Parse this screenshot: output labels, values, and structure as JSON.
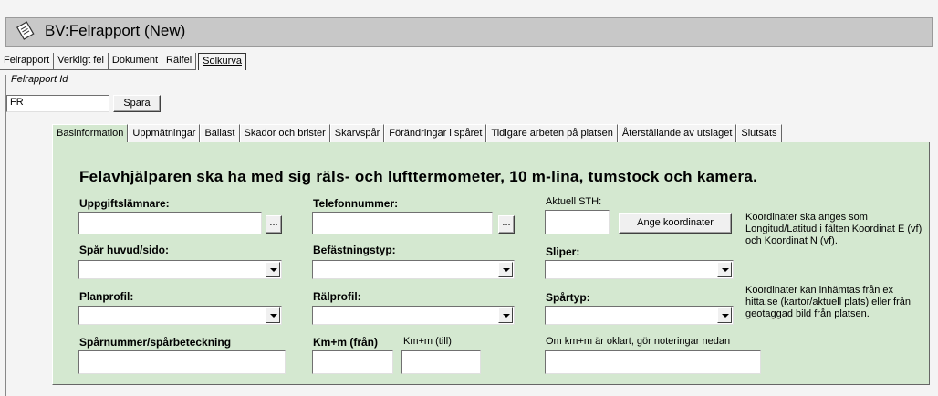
{
  "window": {
    "title": "BV:Felrapport (New)"
  },
  "top_tabs": [
    {
      "label": "Felrapport"
    },
    {
      "label": "Verkligt fel"
    },
    {
      "label": "Dokument"
    },
    {
      "label": "Rälfel"
    },
    {
      "label": "Solkurva"
    }
  ],
  "report_id": {
    "label": "Felrapport Id",
    "value": "FR",
    "save_label": "Spara"
  },
  "sub_tabs": [
    {
      "label": "Basinformation"
    },
    {
      "label": "Uppmätningar"
    },
    {
      "label": "Ballast"
    },
    {
      "label": "Skador och brister"
    },
    {
      "label": "Skarvspår"
    },
    {
      "label": "Förändringar i spåret"
    },
    {
      "label": "Tidigare arbeten på platsen"
    },
    {
      "label": "Återställande av utslaget"
    },
    {
      "label": "Slutsats"
    }
  ],
  "form": {
    "heading": "Felavhjälparen ska ha med sig räls- och lufttermometer, 10 m-lina, tumstock och kamera.",
    "uppgiftslamnare": {
      "label": "Uppgiftslämnare:",
      "value": "",
      "browse": "..."
    },
    "telefonnummer": {
      "label": "Telefonnummer:",
      "value": "",
      "browse": "..."
    },
    "aktuell_sth": {
      "label": "Aktuell STH:",
      "value": ""
    },
    "ange_koordinater": "Ange koordinater",
    "coord_note_1": "Koordinater ska anges som Longitud/Latitud i fälten Koordinat E (vf) och Koordinat N (vf).",
    "coord_note_2": "Koordinater kan inhämtas från ex hitta.se (kartor/aktuell plats) eller från geotaggad bild från platsen.",
    "spar_huvud_sido": {
      "label": "Spår huvud/sido:",
      "value": ""
    },
    "befastningstyp": {
      "label": "Befästningstyp:",
      "value": ""
    },
    "sliper": {
      "label": "Sliper:",
      "value": ""
    },
    "planprofil": {
      "label": "Planprofil:",
      "value": ""
    },
    "ralprofil": {
      "label": "Rälprofil:",
      "value": ""
    },
    "spartyp": {
      "label": "Spårtyp:",
      "value": ""
    },
    "sparnummer": {
      "label": "Spårnummer/spårbeteckning",
      "value": ""
    },
    "km_fran": {
      "label": "Km+m (från)",
      "value": ""
    },
    "km_till": {
      "label": "Km+m (till)",
      "value": ""
    },
    "km_note": {
      "label": "Om km+m är oklart, gör noteringar nedan",
      "value": ""
    }
  }
}
